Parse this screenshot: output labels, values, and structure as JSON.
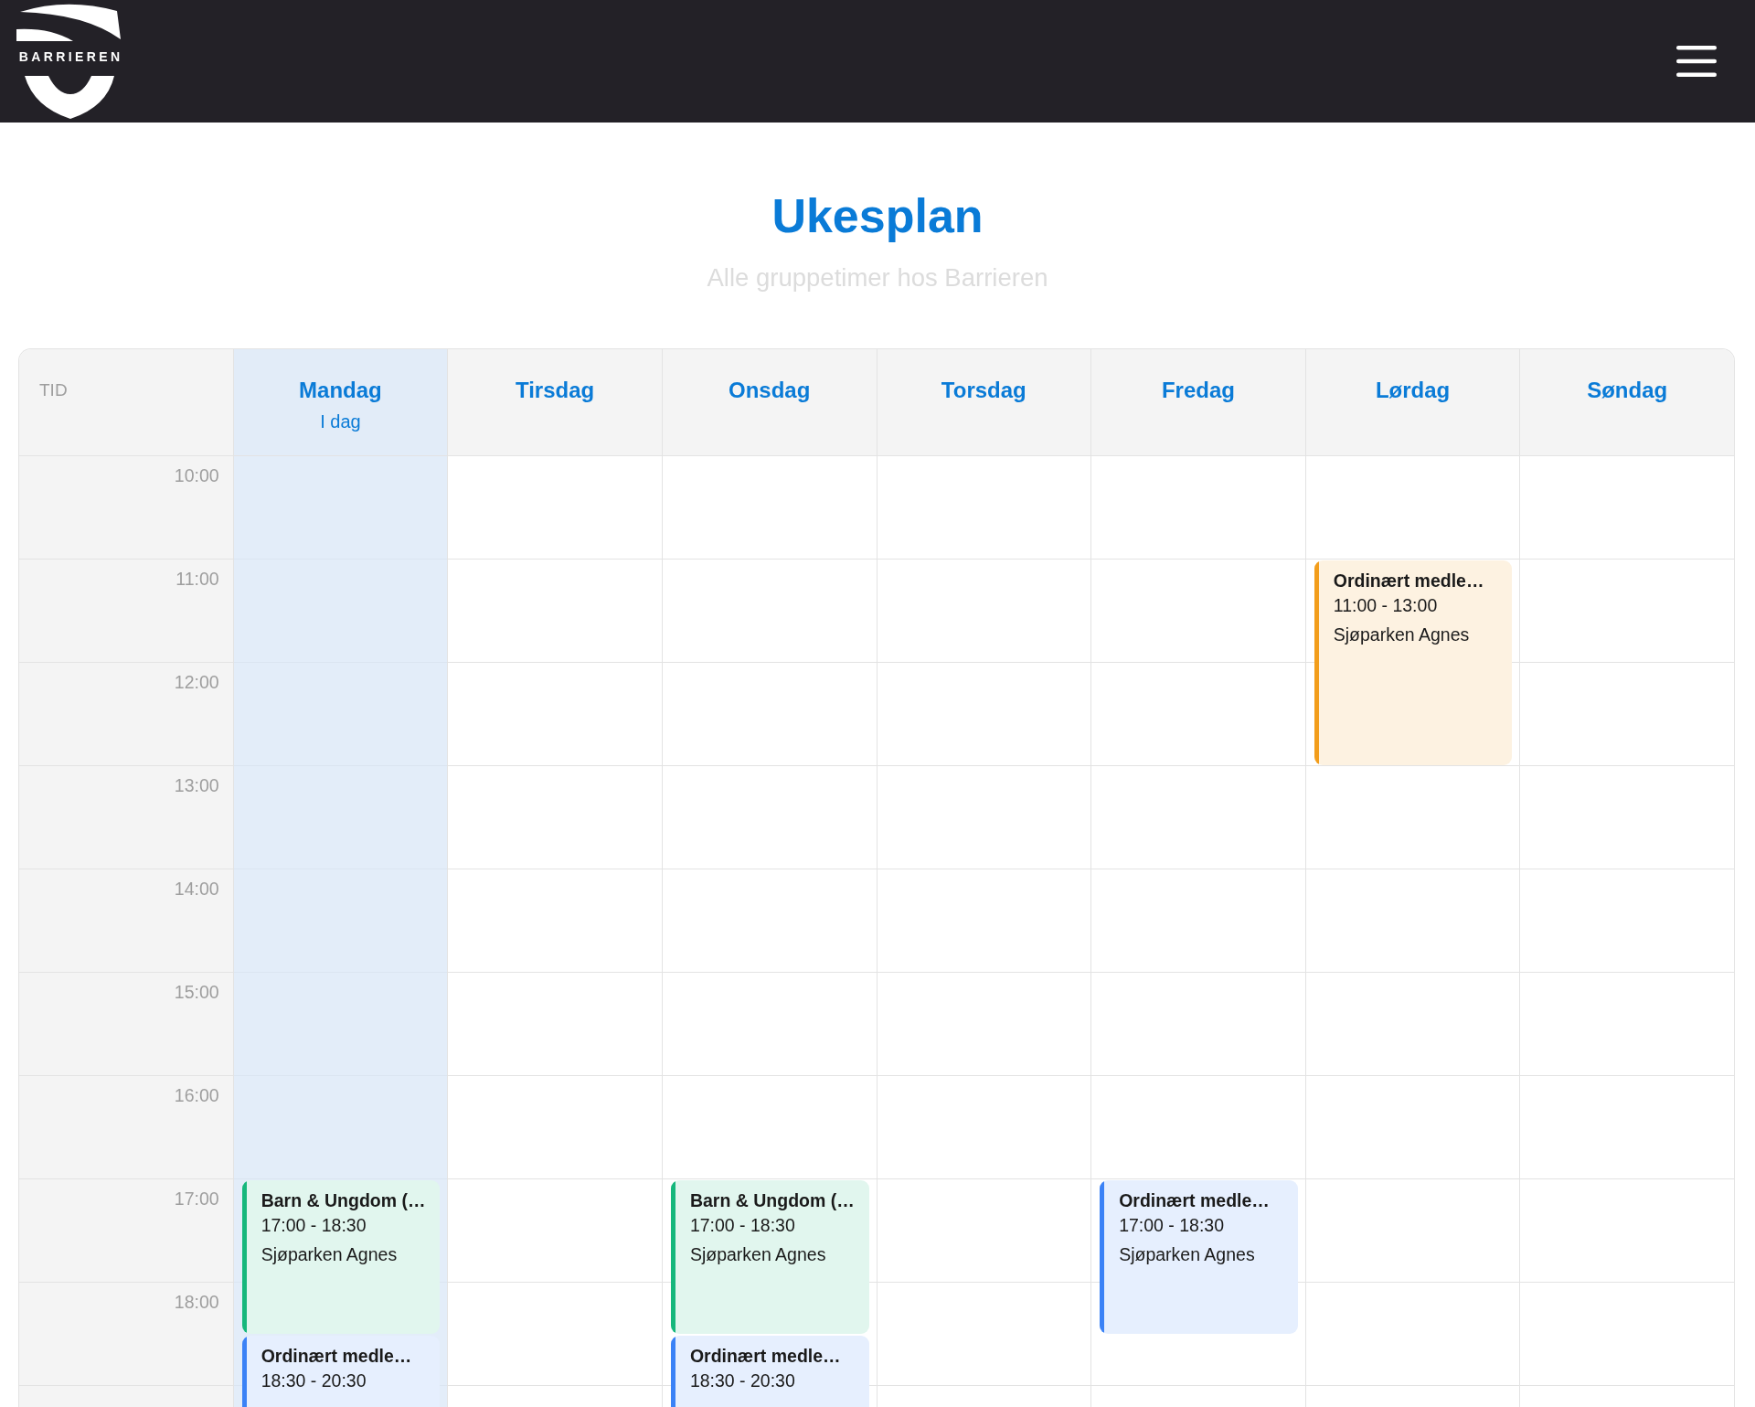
{
  "header": {
    "logo_text": "BARRIEREN"
  },
  "heading": {
    "title": "Ukesplan",
    "subtitle": "Alle gruppetimer hos Barrieren"
  },
  "calendar": {
    "time_heading": "TID",
    "days": [
      {
        "name": "Mandag",
        "today": true,
        "today_label": "I dag",
        "events": [
          {
            "title": "Barn & Ungdom (…",
            "time": "17:00 - 18:30",
            "location": "Sjøparken Agnes",
            "color": "#16b77c"
          },
          {
            "title": "Ordinært medle…",
            "time": "18:30 - 20:30",
            "color": "#3b82f6"
          }
        ]
      },
      {
        "name": "Tirsdag",
        "today": false
      },
      {
        "name": "Onsdag",
        "today": false,
        "events": [
          {
            "title": "Barn & Ungdom (…",
            "time": "17:00 - 18:30",
            "location": "Sjøparken Agnes",
            "color": "#16b77c"
          },
          {
            "title": "Ordinært medle…",
            "time": "18:30 - 20:30",
            "color": "#3b82f6"
          }
        ]
      },
      {
        "name": "Torsdag",
        "today": false
      },
      {
        "name": "Fredag",
        "today": false,
        "events": [
          {
            "title": "Ordinært medle…",
            "time": "17:00 - 18:30",
            "location": "Sjøparken Agnes",
            "color": "#3b82f6"
          }
        ]
      },
      {
        "name": "Lørdag",
        "today": false,
        "events": [
          {
            "title": "Ordinært medle…",
            "time": "11:00 - 13:00",
            "location": "Sjøparken Agnes",
            "color": "#f29d1b"
          }
        ]
      },
      {
        "name": "Søndag",
        "today": false
      }
    ],
    "times": [
      "10:00",
      "11:00",
      "12:00",
      "13:00",
      "14:00",
      "15:00",
      "16:00",
      "17:00",
      "18:00"
    ]
  }
}
